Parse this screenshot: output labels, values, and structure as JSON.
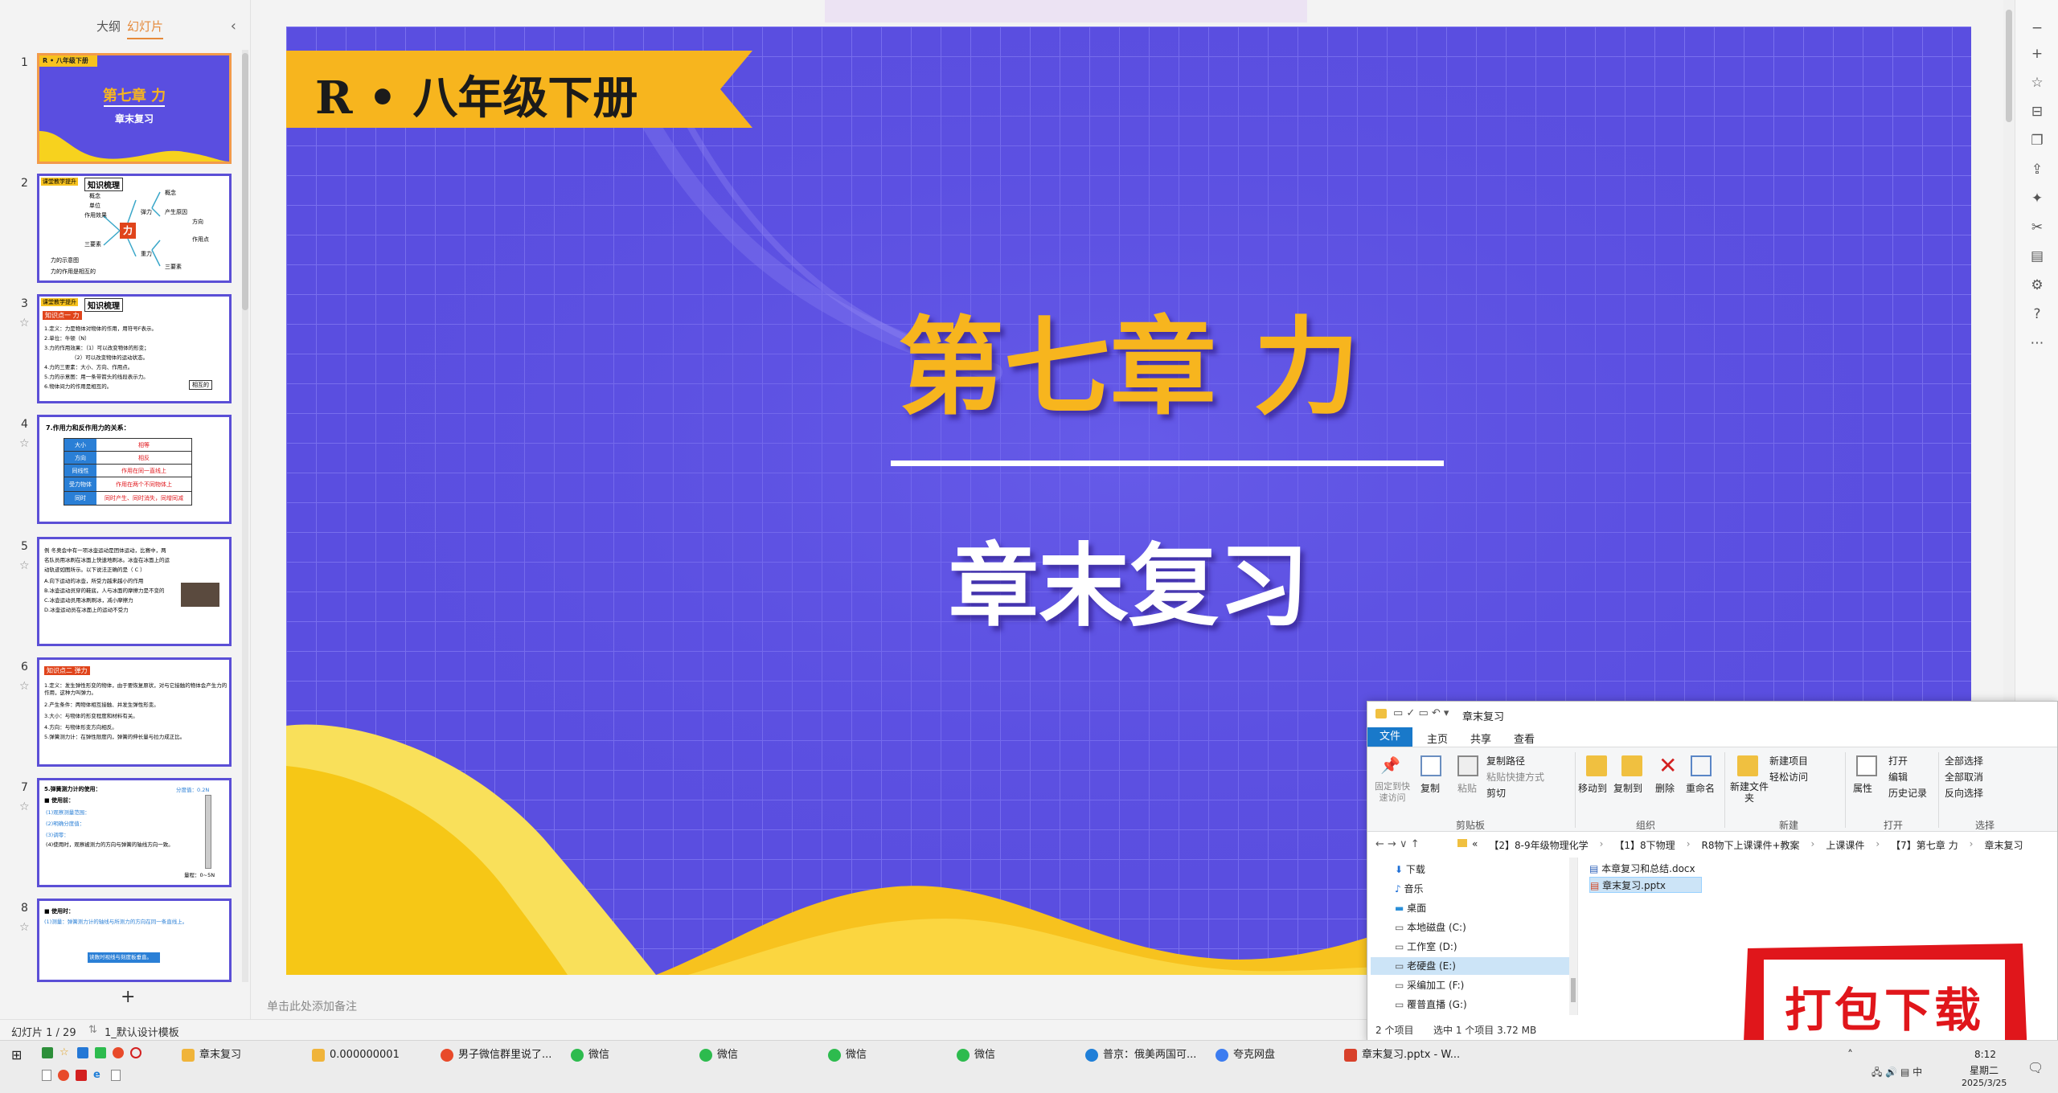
{
  "panel": {
    "tabs": [
      "大纲",
      "幻灯片"
    ],
    "active_tab": "幻灯片",
    "collapse_icon": "chevron-left-icon",
    "add_slide": "+"
  },
  "thumbnails": [
    {
      "num": "1",
      "tag": "R • 八年级下册",
      "title": "第七章 力",
      "subtitle": "章末复习"
    },
    {
      "num": "2",
      "tag": "课堂教学提升",
      "heading": "知识梳理",
      "center": "力",
      "lines": [
        "概念",
        "单位",
        "作用效果",
        "三要素",
        "示意图",
        "力的示意图",
        "力的作用是相互的",
        "弹力",
        "重力",
        "概念",
        "三要素",
        "产生原因",
        "方向",
        "作用点"
      ]
    },
    {
      "num": "3",
      "tag": "课堂教学提升",
      "heading": "知识梳理",
      "sub": "知识点一 力",
      "lines": [
        "1.定义：力是物体对物体的作用，用符号F表示。",
        "2.单位：牛顿（N）",
        "3.力的作用效果：（1）可以改变物体的形变；",
        "（2）可以改变物体的运动状态。",
        "4.力的三要素：大小、方向、作用点。",
        "5.力的示意图：用一条带箭头的线段表示力。",
        "6.物体间力的作用是相互的。"
      ],
      "note": "相互的"
    },
    {
      "num": "4",
      "heading": "7.作用力和反作用力的关系：",
      "rows": [
        [
          "大小",
          "相等"
        ],
        [
          "方向",
          "相反"
        ],
        [
          "同线性",
          "作用在同一直线上"
        ],
        [
          "受力物体",
          "作用在两个不同物体上"
        ],
        [
          "同时",
          "同时产生、同时消失，同增同减"
        ]
      ]
    },
    {
      "num": "5",
      "lines": [
        "例 冬奥会中有一项冰壶运动是团体运动，比赛中，两",
        "名队员用冰刷在冰面上快速地刷冰。冰壶在冰面上的运",
        "动轨迹如图所示。以下说法正确的是（  C  ）",
        "A.向下运动的冰壶，所受力越来越小的作用",
        "B.冰壶运动员穿的鞋底，人与冰面的摩擦力是不变的",
        "C.冰壶运动员用冰刷刷冰，减小摩擦力",
        "D.冰壶运动员在冰面上的运动不受力"
      ]
    },
    {
      "num": "6",
      "sub": "知识点二 弹力",
      "lines": [
        "1.定义：发生弹性形变的物体，由于要恢复原状，对与它接触的物体会产生力的作用，这种力叫弹力。",
        "2.产生条件：两物体相互接触、并发生弹性形变。",
        "3.大小：与物体的形变程度和材料有关。",
        "4.方向：与物体形变方向相反。",
        "5.弹簧测力计：在弹性限度内，弹簧的伸长量与拉力成正比。"
      ]
    },
    {
      "num": "7",
      "lines": [
        "5.弹簧测力计的使用：",
        "■ 使用前：",
        "(1)观察测量范围：",
        "(2)明确分度值：",
        "(3)调零：",
        "(4)使用时，观察被测力的方向与弹簧的轴线方向一致。",
        "分度值：0.2N",
        "量程：0~5N"
      ]
    },
    {
      "num": "8",
      "lines": [
        "■ 使用时：",
        "(1)测量：弹簧测力计的轴线与所测力的方向在同一条直线上。",
        "读数时视线与刻度板垂直。"
      ]
    }
  ],
  "slide": {
    "banner": "R • 八年级下册",
    "title": "第七章 力",
    "subtitle": "章末复习"
  },
  "notes_placeholder": "单击此处添加备注",
  "right_toolbar": [
    "minimize-icon",
    "plus-icon",
    "star-icon",
    "bookmark-icon",
    "copy-icon",
    "share-icon",
    "magic-icon",
    "tools-icon",
    "book-icon",
    "settings-icon",
    "help-icon",
    "more-icon"
  ],
  "status_bar": {
    "slide_count": "幻灯片 1 / 29",
    "template": "1_默认设计模板"
  },
  "explorer": {
    "title": "章末复习",
    "ribbon_tabs": [
      "文件",
      "主页",
      "共享",
      "查看"
    ],
    "ribbon": {
      "clipboard": {
        "pin": "固定到快速访问",
        "copy": "复制",
        "paste": "粘贴",
        "copy_path": "复制路径",
        "paste_shortcut": "粘贴快捷方式",
        "cut": "剪切",
        "group": "剪贴板"
      },
      "organize": {
        "move": "移动到",
        "copy_to": "复制到",
        "delete": "删除",
        "rename": "重命名",
        "group": "组织"
      },
      "new": {
        "new_folder": "新建文件夹",
        "new_item": "新建项目",
        "easy_access": "轻松访问",
        "group": "新建"
      },
      "open": {
        "properties": "属性",
        "open": "打开",
        "edit": "编辑",
        "history": "历史记录",
        "group": "打开"
      },
      "select": {
        "select_all": "全部选择",
        "select_none": "全部取消",
        "invert": "反向选择",
        "group": "选择"
      }
    },
    "address": [
      "«",
      "【2】8-9年级物理化学",
      "【1】8下物理",
      "R8物下上课课件+教案",
      "上课课件",
      "【7】第七章 力",
      "章末复习"
    ],
    "nav": [
      {
        "icon": "download-icon",
        "label": "下载",
        "color": "#1f6fd6"
      },
      {
        "icon": "music-icon",
        "label": "音乐",
        "color": "#1f6fd6"
      },
      {
        "icon": "desktop-icon",
        "label": "桌面",
        "color": "#2a8fd8"
      },
      {
        "icon": "drive-icon",
        "label": "本地磁盘 (C:)",
        "color": "#555"
      },
      {
        "icon": "drive-icon",
        "label": "工作室 (D:)",
        "color": "#555"
      },
      {
        "icon": "drive-icon",
        "label": "老硬盘 (E:)",
        "color": "#555",
        "selected": true
      },
      {
        "icon": "drive-icon",
        "label": "采编加工 (F:)",
        "color": "#555"
      },
      {
        "icon": "drive-icon",
        "label": "覆普直播 (G:)",
        "color": "#555"
      }
    ],
    "files": [
      {
        "icon": "docx-icon",
        "label": "本章复习和总结.docx",
        "color": "#2b5fb8"
      },
      {
        "icon": "pptx-icon",
        "label": "章末复习.pptx",
        "color": "#d24726",
        "selected": true
      }
    ],
    "status": {
      "count": "2 个项目",
      "selected": "选中 1 个项目  3.72 MB"
    }
  },
  "promo": {
    "text": "打包下载",
    "color": "#e0161b"
  },
  "taskbar": {
    "buttons": [
      {
        "label": "章末复习",
        "icon_color": "#f0b43a"
      },
      {
        "label": "0.000000001",
        "icon_color": "#f0b43a"
      },
      {
        "label": "男子微信群里说了...",
        "icon_color": "#2f7de1"
      },
      {
        "label": "微信",
        "icon_color": "#2dbb4e"
      },
      {
        "label": "微信",
        "icon_color": "#2dbb4e"
      },
      {
        "label": "微信",
        "icon_color": "#2dbb4e"
      },
      {
        "label": "微信",
        "icon_color": "#2dbb4e"
      },
      {
        "label": "普京：俄美两国可...",
        "icon_color": "#1f7fd8"
      },
      {
        "label": "夸克网盘",
        "icon_color": "#3c7cf0"
      },
      {
        "label": "章末复习.pptx - W...",
        "icon_color": "#d8402a"
      }
    ],
    "clock_time": "8:12",
    "clock_weekday": "星期二",
    "clock_date": "2025/3/25"
  }
}
